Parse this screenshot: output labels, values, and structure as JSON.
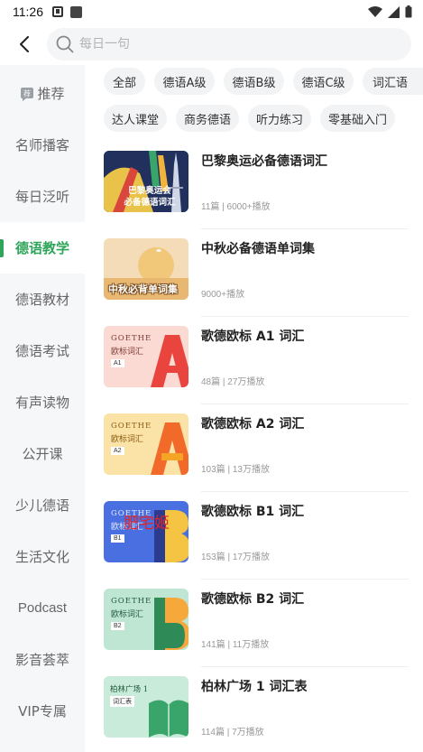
{
  "status_bar": {
    "time": "11:26"
  },
  "header": {
    "search_placeholder": "每日一句"
  },
  "sidebar": {
    "items": [
      {
        "label": "推荐"
      },
      {
        "label": "名师播客"
      },
      {
        "label": "每日泛听"
      },
      {
        "label": "德语教学"
      },
      {
        "label": "德语教材"
      },
      {
        "label": "德语考试"
      },
      {
        "label": "有声读物"
      },
      {
        "label": "公开课"
      },
      {
        "label": "少儿德语"
      },
      {
        "label": "生活文化"
      },
      {
        "label": "Podcast"
      },
      {
        "label": "影音荟萃"
      },
      {
        "label": "VIP专属"
      }
    ],
    "active_index": 3
  },
  "tags": [
    {
      "label": "全部"
    },
    {
      "label": "德语A级"
    },
    {
      "label": "德语B级"
    },
    {
      "label": "德语C级"
    },
    {
      "label": "词汇语"
    },
    {
      "label": "达人课堂"
    },
    {
      "label": "商务德语"
    },
    {
      "label": "听力练习"
    },
    {
      "label": "零基础入门"
    }
  ],
  "list": [
    {
      "title": "巴黎奥运必备德语词汇",
      "meta": "11篇 | 6000+播放",
      "cover_text": "巴黎奥运会\n必备德语词汇"
    },
    {
      "title": "中秋必备德语单词集",
      "meta": "9000+播放",
      "cover_text": "中秋必背单词集"
    },
    {
      "title": "歌德欧标 A1 词汇",
      "meta": "48篇 | 27万播放",
      "cover_brand": "GOETHE",
      "cover_sub": "欧标词汇",
      "cover_level": "A1",
      "cover_letter": "A"
    },
    {
      "title": "歌德欧标 A2 词汇",
      "meta": "103篇 | 13万播放",
      "cover_brand": "GOETHE",
      "cover_sub": "欧标词汇",
      "cover_level": "A2",
      "cover_letter": "A"
    },
    {
      "title": "歌德欧标 B1 词汇",
      "meta": "153篇 | 17万播放",
      "cover_brand": "GOETHE",
      "cover_sub": "欧标词汇",
      "cover_level": "B1",
      "cover_letter": "B",
      "watermark": "肥宅姬"
    },
    {
      "title": "歌德欧标 B2 词汇",
      "meta": "141篇 | 11万播放",
      "cover_brand": "GOETHE",
      "cover_sub": "欧标词汇",
      "cover_level": "B2",
      "cover_letter": "B"
    },
    {
      "title": "柏林广场 1 词汇表",
      "meta": "114篇 | 7万播放",
      "cover_brand": "柏林广场 1",
      "cover_sub": "词汇表"
    }
  ],
  "colors": {
    "accent": "#2fa55b",
    "sidebar_bg": "#f6f7f9",
    "tag_bg": "#f2f3f5"
  },
  "icons": {
    "back": "chevron-left-icon",
    "search": "search-icon",
    "recommend": "recommend-icon"
  }
}
